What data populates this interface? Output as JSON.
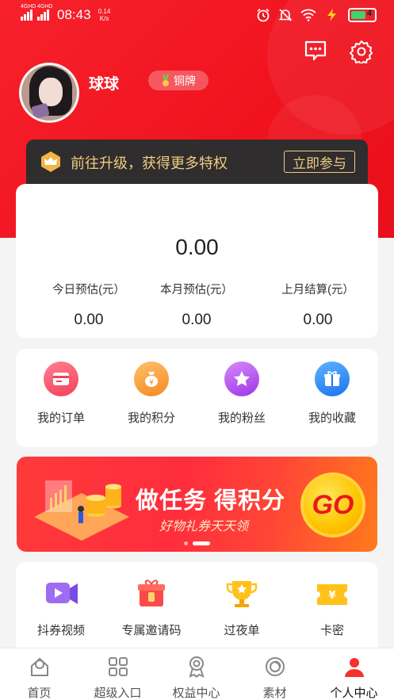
{
  "status_bar": {
    "time": "08:43",
    "signal1": "4GHD",
    "signal2": "4GHD",
    "speed": "0.14 K/s",
    "battery": "4"
  },
  "profile": {
    "name": "球球",
    "level": "铜牌"
  },
  "upgrade": {
    "text": "前往升级，获得更多特权",
    "button": "立即参与"
  },
  "earnings": {
    "total": "0.00",
    "columns": [
      {
        "label": "今日预估(元）",
        "value": "0.00"
      },
      {
        "label": "本月预估(元）",
        "value": "0.00"
      },
      {
        "label": "上月结算(元）",
        "value": "0.00"
      }
    ]
  },
  "quick_links": [
    {
      "label": "我的订单",
      "icon": "order-icon",
      "color": "#f8566a"
    },
    {
      "label": "我的积分",
      "icon": "points-icon",
      "color": "#f9963a"
    },
    {
      "label": "我的粉丝",
      "icon": "fans-icon",
      "color": "#b64bf0"
    },
    {
      "label": "我的收藏",
      "icon": "favorites-icon",
      "color": "#2c8bf5"
    }
  ],
  "banner": {
    "title": "做任务 得积分",
    "subtitle": "好物礼券天天领",
    "go": "GO"
  },
  "tools": [
    {
      "label": "抖券视频",
      "icon": "video-icon"
    },
    {
      "label": "专属邀请码",
      "icon": "gift-icon"
    },
    {
      "label": "过夜单",
      "icon": "trophy-icon"
    },
    {
      "label": "卡密",
      "icon": "coupon-icon"
    }
  ],
  "tabbar": [
    {
      "label": "首页",
      "icon": "home-icon"
    },
    {
      "label": "超级入口",
      "icon": "grid-icon"
    },
    {
      "label": "权益中心",
      "icon": "medal-icon"
    },
    {
      "label": "素材",
      "icon": "material-icon"
    },
    {
      "label": "个人中心",
      "icon": "user-icon",
      "active": true
    }
  ],
  "colors": {
    "brand_red": "#f0131e",
    "gold": "#f0cc82",
    "dark": "#2f2d2d"
  }
}
